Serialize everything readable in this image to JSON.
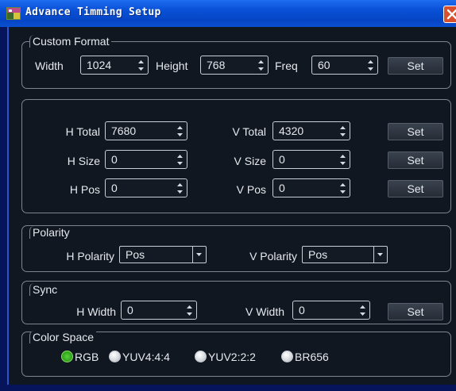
{
  "window": {
    "title": "Advance Timming Setup",
    "title_color": "#ffffff",
    "titlebar_color": "#0a52d8",
    "background_color": "#111721",
    "close_icon": "close-icon"
  },
  "custom_format": {
    "legend": "Custom Format",
    "width_label": "Width",
    "width_value": "1024",
    "height_label": "Height",
    "height_value": "768",
    "freq_label": "Freq",
    "freq_value": "60",
    "set_label": "Set"
  },
  "timing": {
    "h_total_label": "H Total",
    "h_total_value": "7680",
    "v_total_label": "V Total",
    "v_total_value": "4320",
    "h_size_label": "H Size",
    "h_size_value": "0",
    "v_size_label": "V Size",
    "v_size_value": "0",
    "h_pos_label": "H Pos",
    "h_pos_value": "0",
    "v_pos_label": "V Pos",
    "v_pos_value": "0",
    "set_total_label": "Set",
    "set_size_label": "Set",
    "set_pos_label": "Set"
  },
  "polarity": {
    "legend": "Polarity",
    "h_label": "H Polarity",
    "h_value": "Pos",
    "v_label": "V Polarity",
    "v_value": "Pos"
  },
  "sync": {
    "legend": "Sync",
    "h_width_label": "H Width",
    "h_width_value": "0",
    "v_width_label": "V Width",
    "v_width_value": "0",
    "set_label": "Set"
  },
  "color_space": {
    "legend": "Color Space",
    "options": [
      "RGB",
      "YUV4:4:4",
      "YUV2:2:2",
      "BR656"
    ],
    "selected": "RGB",
    "selected_color": "#2c9e18"
  }
}
